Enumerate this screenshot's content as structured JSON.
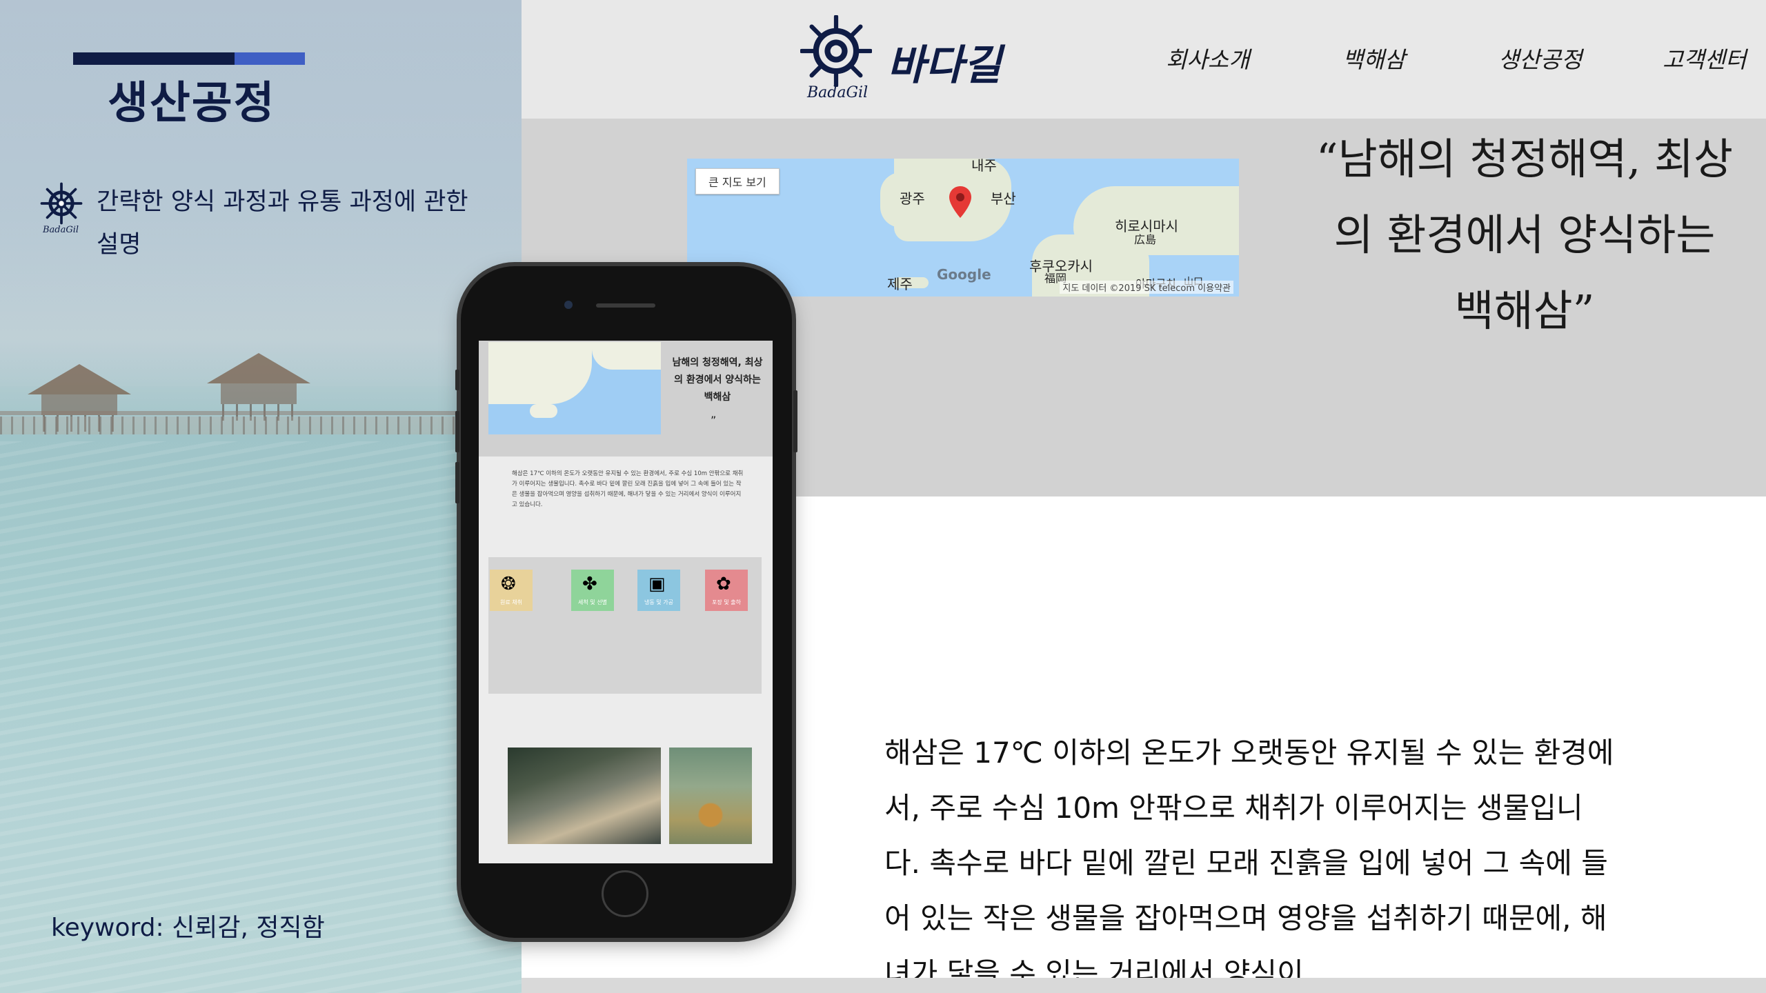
{
  "slide": {
    "title": "생산공정",
    "description": "간략한 양식 과정과 유통 과정에 관한 설명",
    "description_icon_caption": "BadaGil",
    "keyword": "keyword: 신뢰감, 정직함"
  },
  "site": {
    "logo_text": "바다길",
    "logo_subtext": "BadaGil",
    "nav": [
      "회사소개",
      "백해삼",
      "생산공정",
      "고객센터"
    ],
    "map": {
      "button_label": "큰 지도 보기",
      "labels": {
        "top": "내주",
        "gwangju": "광주",
        "busan": "부산",
        "jeju": "제주",
        "fukuoka": "후쿠오카시",
        "fukuoka_kanji": "福岡",
        "hiroshima": "히로시마시",
        "hiroshima_kanji": "広島",
        "yamaguchi": "야마구치",
        "yamaguchi_kanji": "山口"
      },
      "brand": "Google",
      "credit": "지도 데이터 ©2019 SK telecom   이용약관"
    },
    "hero_quote": "“남해의 청정해역, 최상의 환경에서 양식하는 백해삼”",
    "body": "해삼은 17℃ 이하의 온도가 오랫동안 유지될 수 있는 환경에서, 주로 수심 10m 안팎으로 채취가 이루어지는 생물입니다. 촉수로 바다 밑에 깔린 모래 진흙을 입에 넣어 그 속에 들어 있는 작은 생물을 잡아먹으며 영양을 섭취하기 때문에, 해녀가 닿을 수 있는 거리에서 양식이"
  },
  "phone": {
    "quote_open": "“",
    "quote": "남해의 청정해역, 최상의 환경에서 양식하는 백해삼",
    "quote_close": "”",
    "paragraph": "해삼은 17℃ 이하의 온도가 오랫동안 유지될 수 있는 환경에서, 주로 수심 10m 안팎으로 채취가 이루어지는 생물입니다. 촉수로 바다 밑에 깔린 모래 진흙을 입에 넣어 그 속에 들어 있는 작은 생물을 잡아먹으며 영양을 섭취하기 때문에, 해녀가 닿을 수 있는 거리에서 양식이 이루어지고 있습니다.",
    "steps": [
      {
        "label": "원료 채취",
        "icon": "sea-cucumber-icon",
        "color": "#e8d29a",
        "glyph": "❂"
      },
      {
        "label": "세척 및 선별",
        "icon": "sorting-icon",
        "color": "#8fd49a",
        "glyph": "✤"
      },
      {
        "label": "냉동 및 가공",
        "icon": "freezing-box-icon",
        "color": "#8cc6e0",
        "glyph": "▣"
      },
      {
        "label": "포장 및 출하",
        "icon": "packaging-icon",
        "color": "#e48a8f",
        "glyph": "✿"
      }
    ]
  },
  "colors": {
    "navy": "#0f1c45",
    "accent_blue": "#3f5fc4",
    "header_gray": "#e8e8e8",
    "band_gray": "#d2d2d2"
  }
}
